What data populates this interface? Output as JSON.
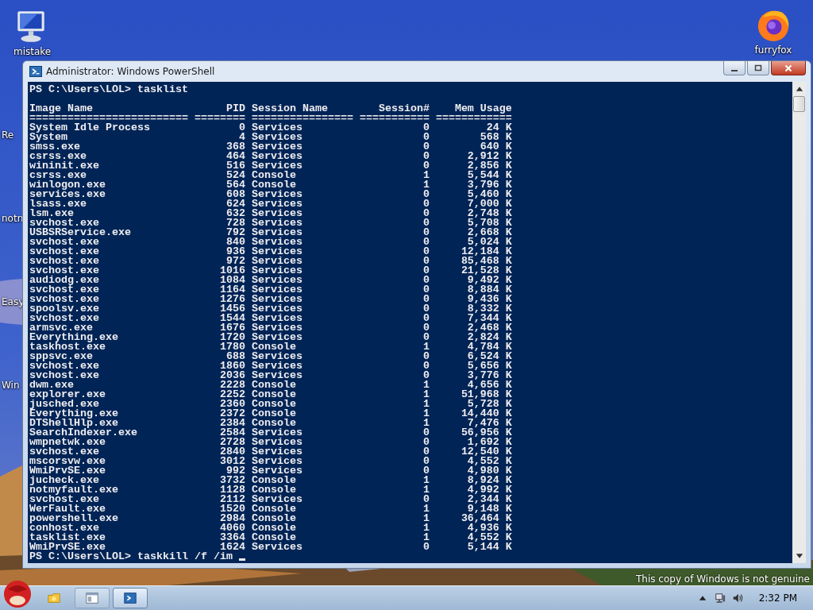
{
  "desktop": {
    "left_icons": [
      {
        "label": "mistake",
        "kind": "computer"
      },
      {
        "label": "Re",
        "kind": "partial"
      },
      {
        "label": "notn",
        "kind": "partial"
      },
      {
        "label": "Easy",
        "kind": "partial"
      },
      {
        "label": "Win",
        "kind": "partial"
      }
    ],
    "right_icons": [
      {
        "label": "furryfox",
        "kind": "browser"
      }
    ],
    "notice": "This copy of Windows is not genuine"
  },
  "window": {
    "title": "Administrator: Windows PowerShell",
    "command": "PS C:\\Users\\LOL> tasklist",
    "columns": [
      "Image Name",
      "PID",
      "Session Name",
      "Session#",
      "Mem Usage"
    ],
    "separator": "========================= ======== ================ =========== ============",
    "rows": [
      [
        "System Idle Process",
        "0",
        "Services",
        "0",
        "24 K"
      ],
      [
        "System",
        "4",
        "Services",
        "0",
        "568 K"
      ],
      [
        "smss.exe",
        "368",
        "Services",
        "0",
        "640 K"
      ],
      [
        "csrss.exe",
        "464",
        "Services",
        "0",
        "2,912 K"
      ],
      [
        "wininit.exe",
        "516",
        "Services",
        "0",
        "2,856 K"
      ],
      [
        "csrss.exe",
        "524",
        "Console",
        "1",
        "5,544 K"
      ],
      [
        "winlogon.exe",
        "564",
        "Console",
        "1",
        "3,796 K"
      ],
      [
        "services.exe",
        "608",
        "Services",
        "0",
        "5,460 K"
      ],
      [
        "lsass.exe",
        "624",
        "Services",
        "0",
        "7,000 K"
      ],
      [
        "lsm.exe",
        "632",
        "Services",
        "0",
        "2,748 K"
      ],
      [
        "svchost.exe",
        "728",
        "Services",
        "0",
        "5,708 K"
      ],
      [
        "USBSRService.exe",
        "792",
        "Services",
        "0",
        "2,668 K"
      ],
      [
        "svchost.exe",
        "840",
        "Services",
        "0",
        "5,024 K"
      ],
      [
        "svchost.exe",
        "936",
        "Services",
        "0",
        "12,184 K"
      ],
      [
        "svchost.exe",
        "972",
        "Services",
        "0",
        "85,468 K"
      ],
      [
        "svchost.exe",
        "1016",
        "Services",
        "0",
        "21,528 K"
      ],
      [
        "audiodg.exe",
        "1084",
        "Services",
        "0",
        "9,492 K"
      ],
      [
        "svchost.exe",
        "1164",
        "Services",
        "0",
        "8,884 K"
      ],
      [
        "svchost.exe",
        "1276",
        "Services",
        "0",
        "9,436 K"
      ],
      [
        "spoolsv.exe",
        "1456",
        "Services",
        "0",
        "8,332 K"
      ],
      [
        "svchost.exe",
        "1544",
        "Services",
        "0",
        "7,344 K"
      ],
      [
        "armsvc.exe",
        "1676",
        "Services",
        "0",
        "2,468 K"
      ],
      [
        "Everything.exe",
        "1720",
        "Services",
        "0",
        "2,824 K"
      ],
      [
        "taskhost.exe",
        "1780",
        "Console",
        "1",
        "4,784 K"
      ],
      [
        "sppsvc.exe",
        "688",
        "Services",
        "0",
        "6,524 K"
      ],
      [
        "svchost.exe",
        "1860",
        "Services",
        "0",
        "5,656 K"
      ],
      [
        "svchost.exe",
        "2036",
        "Services",
        "0",
        "3,776 K"
      ],
      [
        "dwm.exe",
        "2228",
        "Console",
        "1",
        "4,656 K"
      ],
      [
        "explorer.exe",
        "2252",
        "Console",
        "1",
        "51,968 K"
      ],
      [
        "jusched.exe",
        "2360",
        "Console",
        "1",
        "5,728 K"
      ],
      [
        "Everything.exe",
        "2372",
        "Console",
        "1",
        "14,440 K"
      ],
      [
        "DTShellHlp.exe",
        "2384",
        "Console",
        "1",
        "7,476 K"
      ],
      [
        "SearchIndexer.exe",
        "2584",
        "Services",
        "0",
        "56,956 K"
      ],
      [
        "wmpnetwk.exe",
        "2728",
        "Services",
        "0",
        "1,692 K"
      ],
      [
        "svchost.exe",
        "2840",
        "Services",
        "0",
        "12,540 K"
      ],
      [
        "mscorsvw.exe",
        "3012",
        "Services",
        "0",
        "4,552 K"
      ],
      [
        "WmiPrvSE.exe",
        "992",
        "Services",
        "0",
        "4,980 K"
      ],
      [
        "jucheck.exe",
        "3732",
        "Console",
        "1",
        "8,924 K"
      ],
      [
        "notmyfault.exe",
        "1128",
        "Console",
        "1",
        "4,992 K"
      ],
      [
        "svchost.exe",
        "2112",
        "Services",
        "0",
        "2,344 K"
      ],
      [
        "WerFault.exe",
        "1520",
        "Console",
        "1",
        "9,148 K"
      ],
      [
        "powershell.exe",
        "2984",
        "Console",
        "1",
        "36,464 K"
      ],
      [
        "conhost.exe",
        "4060",
        "Console",
        "1",
        "4,936 K"
      ],
      [
        "tasklist.exe",
        "3364",
        "Console",
        "1",
        "4,552 K"
      ],
      [
        "WmiPrvSE.exe",
        "1624",
        "Services",
        "0",
        "5,144 K"
      ]
    ],
    "prompt": "PS C:\\Users\\LOL> taskkill /f /im"
  },
  "taskbar": {
    "buttons": [
      {
        "kind": "folder",
        "selected": false
      },
      {
        "kind": "window",
        "selected": false
      },
      {
        "kind": "shell",
        "selected": true
      }
    ],
    "clock": "2:32 PM"
  }
}
